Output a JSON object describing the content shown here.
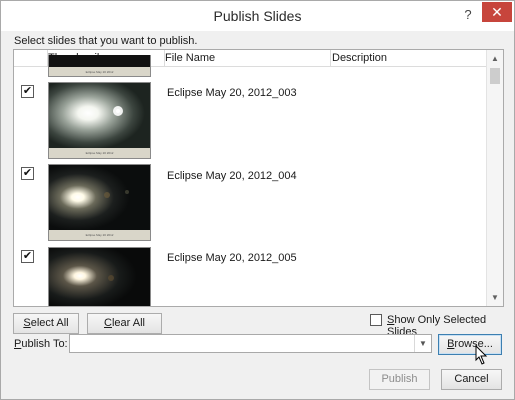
{
  "window": {
    "title": "Publish Slides",
    "help_label": "?",
    "close_label": "✕"
  },
  "instruction": "Select slides that you want to publish.",
  "list": {
    "columns": [
      "Thumbnail",
      "File Name",
      "Description"
    ],
    "rows": [
      {
        "checked": true,
        "check_glyph": "✔",
        "file_name": "Eclipse May 20, 2012_003",
        "thumb_caption": "Eclipse May 20 2012"
      },
      {
        "checked": true,
        "check_glyph": "✔",
        "file_name": "Eclipse May 20, 2012_004",
        "thumb_caption": "Eclipse May 20 2012"
      },
      {
        "checked": true,
        "check_glyph": "✔",
        "file_name": "Eclipse May 20, 2012_005",
        "thumb_caption": ""
      }
    ],
    "top_partial_caption": "Eclipse May 20 2012",
    "scroll_up_glyph": "▲",
    "scroll_down_glyph": "▼"
  },
  "buttons": {
    "select_all": {
      "prefix": "S",
      "rest": "elect All"
    },
    "clear_all": {
      "prefix": "C",
      "rest": "lear All"
    },
    "browse": {
      "prefix": "B",
      "rest": "rowse..."
    },
    "publish": "Publish",
    "cancel": "Cancel"
  },
  "show_only": {
    "checked": false,
    "prefix": "S",
    "rest": "how Only Selected Slides"
  },
  "publish_to": {
    "label_prefix": "P",
    "label_rest": "ublish To:",
    "value": "",
    "caret_glyph": "▼"
  },
  "colors": {
    "close_button": "#c7453c",
    "default_button_border": "#3c7fb1"
  }
}
